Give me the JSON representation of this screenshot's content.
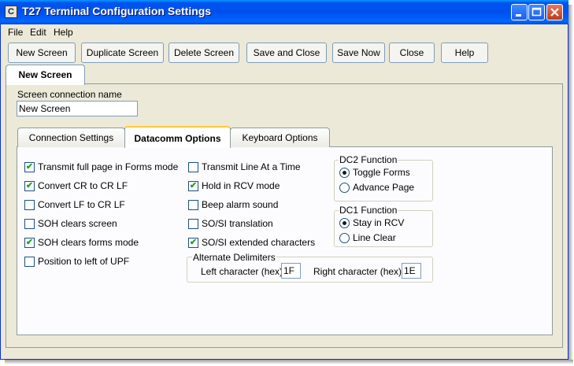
{
  "window": {
    "title": "T27 Terminal Configuration Settings",
    "icon_glyph": "C",
    "controls": {
      "minimize": "_",
      "maximize": "□",
      "close": "✕"
    }
  },
  "menu": [
    "File",
    "Edit",
    "Help"
  ],
  "toolbar": [
    "New Screen",
    "Duplicate Screen",
    "Delete Screen",
    "Save and Close",
    "Save Now",
    "Close",
    "Help"
  ],
  "outer_tab": "New Screen",
  "connection": {
    "label": "Screen connection name",
    "value": "New Screen"
  },
  "tabs": [
    "Connection Settings",
    "Datacomm Options",
    "Keyboard Options"
  ],
  "active_tab": "Datacomm Options",
  "options_col1": [
    {
      "label": "Transmit full page in Forms mode",
      "checked": true
    },
    {
      "label": "Convert CR to CR LF",
      "checked": true
    },
    {
      "label": "Convert LF to CR LF",
      "checked": false
    },
    {
      "label": "SOH clears screen",
      "checked": false
    },
    {
      "label": "SOH clears forms mode",
      "checked": true
    },
    {
      "label": "Position to left of UPF",
      "checked": false
    }
  ],
  "options_col2": [
    {
      "label": "Transmit Line At a Time",
      "checked": false
    },
    {
      "label": "Hold in RCV mode",
      "checked": true
    },
    {
      "label": "Beep alarm sound",
      "checked": false
    },
    {
      "label": "SO/SI translation",
      "checked": false
    },
    {
      "label": "SO/SI extended characters",
      "checked": true
    }
  ],
  "dc2": {
    "title": "DC2 Function",
    "options": [
      "Toggle Forms",
      "Advance Page"
    ],
    "selected": 0
  },
  "dc1": {
    "title": "DC1 Function",
    "options": [
      "Stay in RCV",
      "Line Clear"
    ],
    "selected": 0
  },
  "delimiters": {
    "title": "Alternate Delimiters",
    "left_label": "Left character (hex)",
    "left_value": "1F",
    "right_label": "Right character (hex)",
    "right_value": "1E"
  },
  "check_glyph": "✔"
}
